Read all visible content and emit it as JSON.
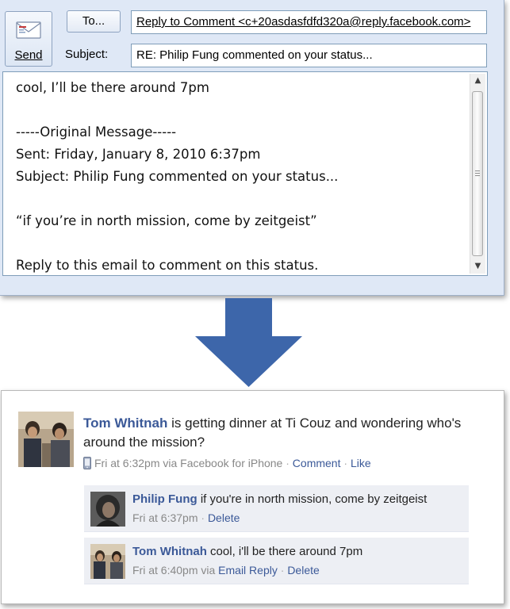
{
  "outlook": {
    "send_label": "Send",
    "to_label": "To...",
    "subject_label": "Subject:",
    "to_value": "Reply to Comment <c+20asdasfdfd320a@reply.facebook.com>",
    "subject_value": "RE: Philip Fung commented on your status...",
    "body_lines": [
      "cool, I’ll be there around 7pm",
      "",
      "-----Original Message-----",
      "Sent: Friday, January 8, 2010 6:37pm",
      "Subject: Philip Fung commented on your status...",
      "",
      "“if you’re in north mission, come by zeitgeist”",
      "",
      "Reply to this email to comment on this status."
    ]
  },
  "facebook": {
    "story": {
      "author": "Tom Whitnah",
      "text": "is getting dinner at Ti Couz and wondering who's around the mission?",
      "time": "Fri at 6:32pm via Facebook for iPhone",
      "comment_link": "Comment",
      "like_link": "Like",
      "separator": "·"
    },
    "comments": [
      {
        "author": "Philip Fung",
        "text": "if you're in north mission, come by zeitgeist",
        "time": "Fri at 6:37pm",
        "via_link": "",
        "delete_label": "Delete"
      },
      {
        "author": "Tom Whitnah",
        "text": "cool, i'll be there around 7pm",
        "time": "Fri at 6:40pm via",
        "via_link": "Email Reply",
        "delete_label": "Delete"
      }
    ]
  },
  "colors": {
    "facebook_blue": "#3b5998",
    "arrow_blue": "#3d66aa",
    "outlook_background": "#dfe8f6",
    "comment_background": "#edeff4"
  },
  "icons": {
    "send": "envelope-icon",
    "phone": "mobile-phone-icon",
    "arrow": "down-arrow-icon"
  }
}
